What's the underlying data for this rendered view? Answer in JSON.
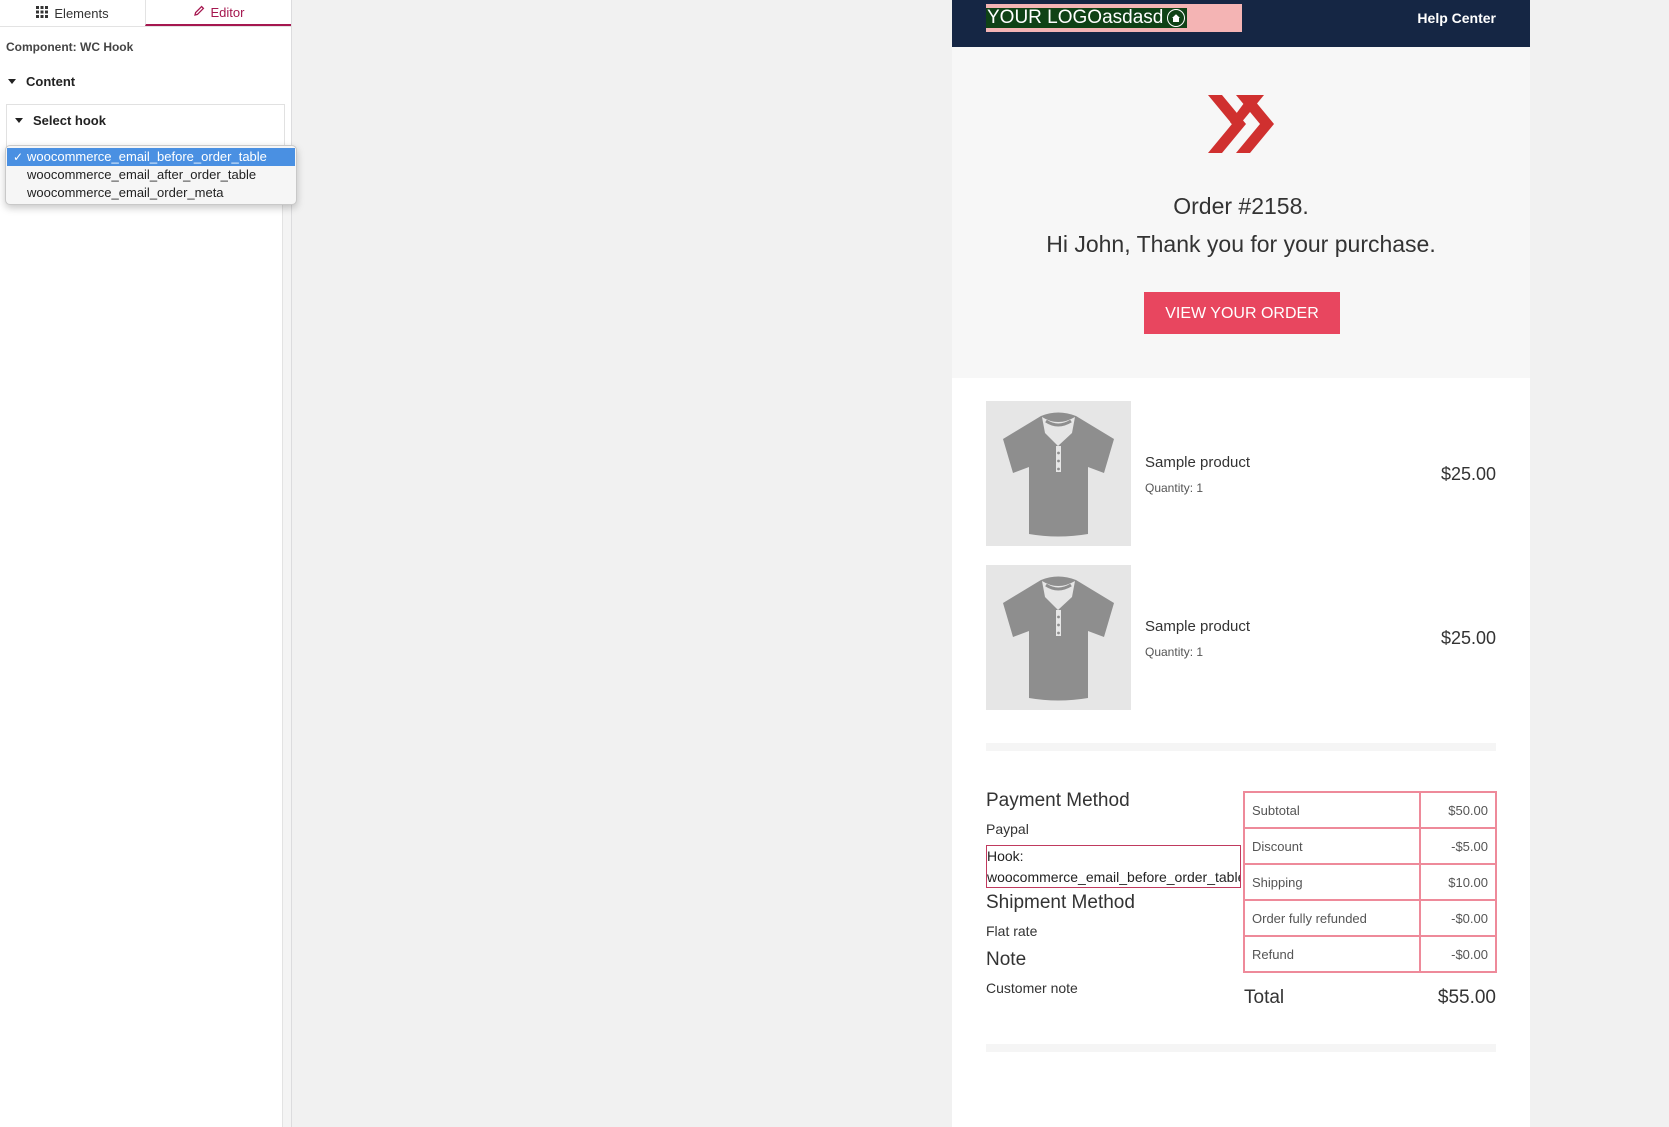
{
  "sidebar": {
    "tabs": [
      {
        "label": "Elements",
        "icon": "grid-icon"
      },
      {
        "label": "Editor",
        "icon": "pencil-icon"
      }
    ],
    "component_label": "Component: WC Hook",
    "section_content": "Content",
    "select_hook_label": "Select hook",
    "hook_options": [
      "woocommerce_email_before_order_table",
      "woocommerce_email_after_order_table",
      "woocommerce_email_order_meta"
    ],
    "selected_index": 0,
    "accent_color": "#a5174f"
  },
  "email": {
    "logo_text": "YOUR LOGOasdasd",
    "help_link": "Help Center",
    "order_title": "Order #2158.",
    "greeting": "Hi John, Thank you for your purchase.",
    "button_label": "VIEW YOUR ORDER",
    "button_color": "#e8465f",
    "header_color": "#152644",
    "products": [
      {
        "name": "Sample product",
        "qty": "Quantity: 1",
        "price": "$25.00",
        "icon": "tshirt-icon"
      },
      {
        "name": "Sample product",
        "qty": "Quantity: 1",
        "price": "$25.00",
        "icon": "tshirt-icon"
      }
    ],
    "payment_heading": "Payment Method",
    "payment_value": "Paypal",
    "hook_label": "Hook:",
    "hook_value": "woocommerce_email_before_order_table",
    "shipment_heading": "Shipment Method",
    "shipment_value": "Flat rate",
    "note_heading": "Note",
    "note_value": "Customer note",
    "totals": [
      {
        "label": "Subtotal",
        "value": "$50.00"
      },
      {
        "label": "Discount",
        "value": "-$5.00"
      },
      {
        "label": "Shipping",
        "value": "$10.00"
      },
      {
        "label": "Order fully refunded",
        "value": "-$0.00"
      },
      {
        "label": "Refund",
        "value": "-$0.00"
      }
    ],
    "total_label": "Total",
    "total_value": "$55.00"
  }
}
